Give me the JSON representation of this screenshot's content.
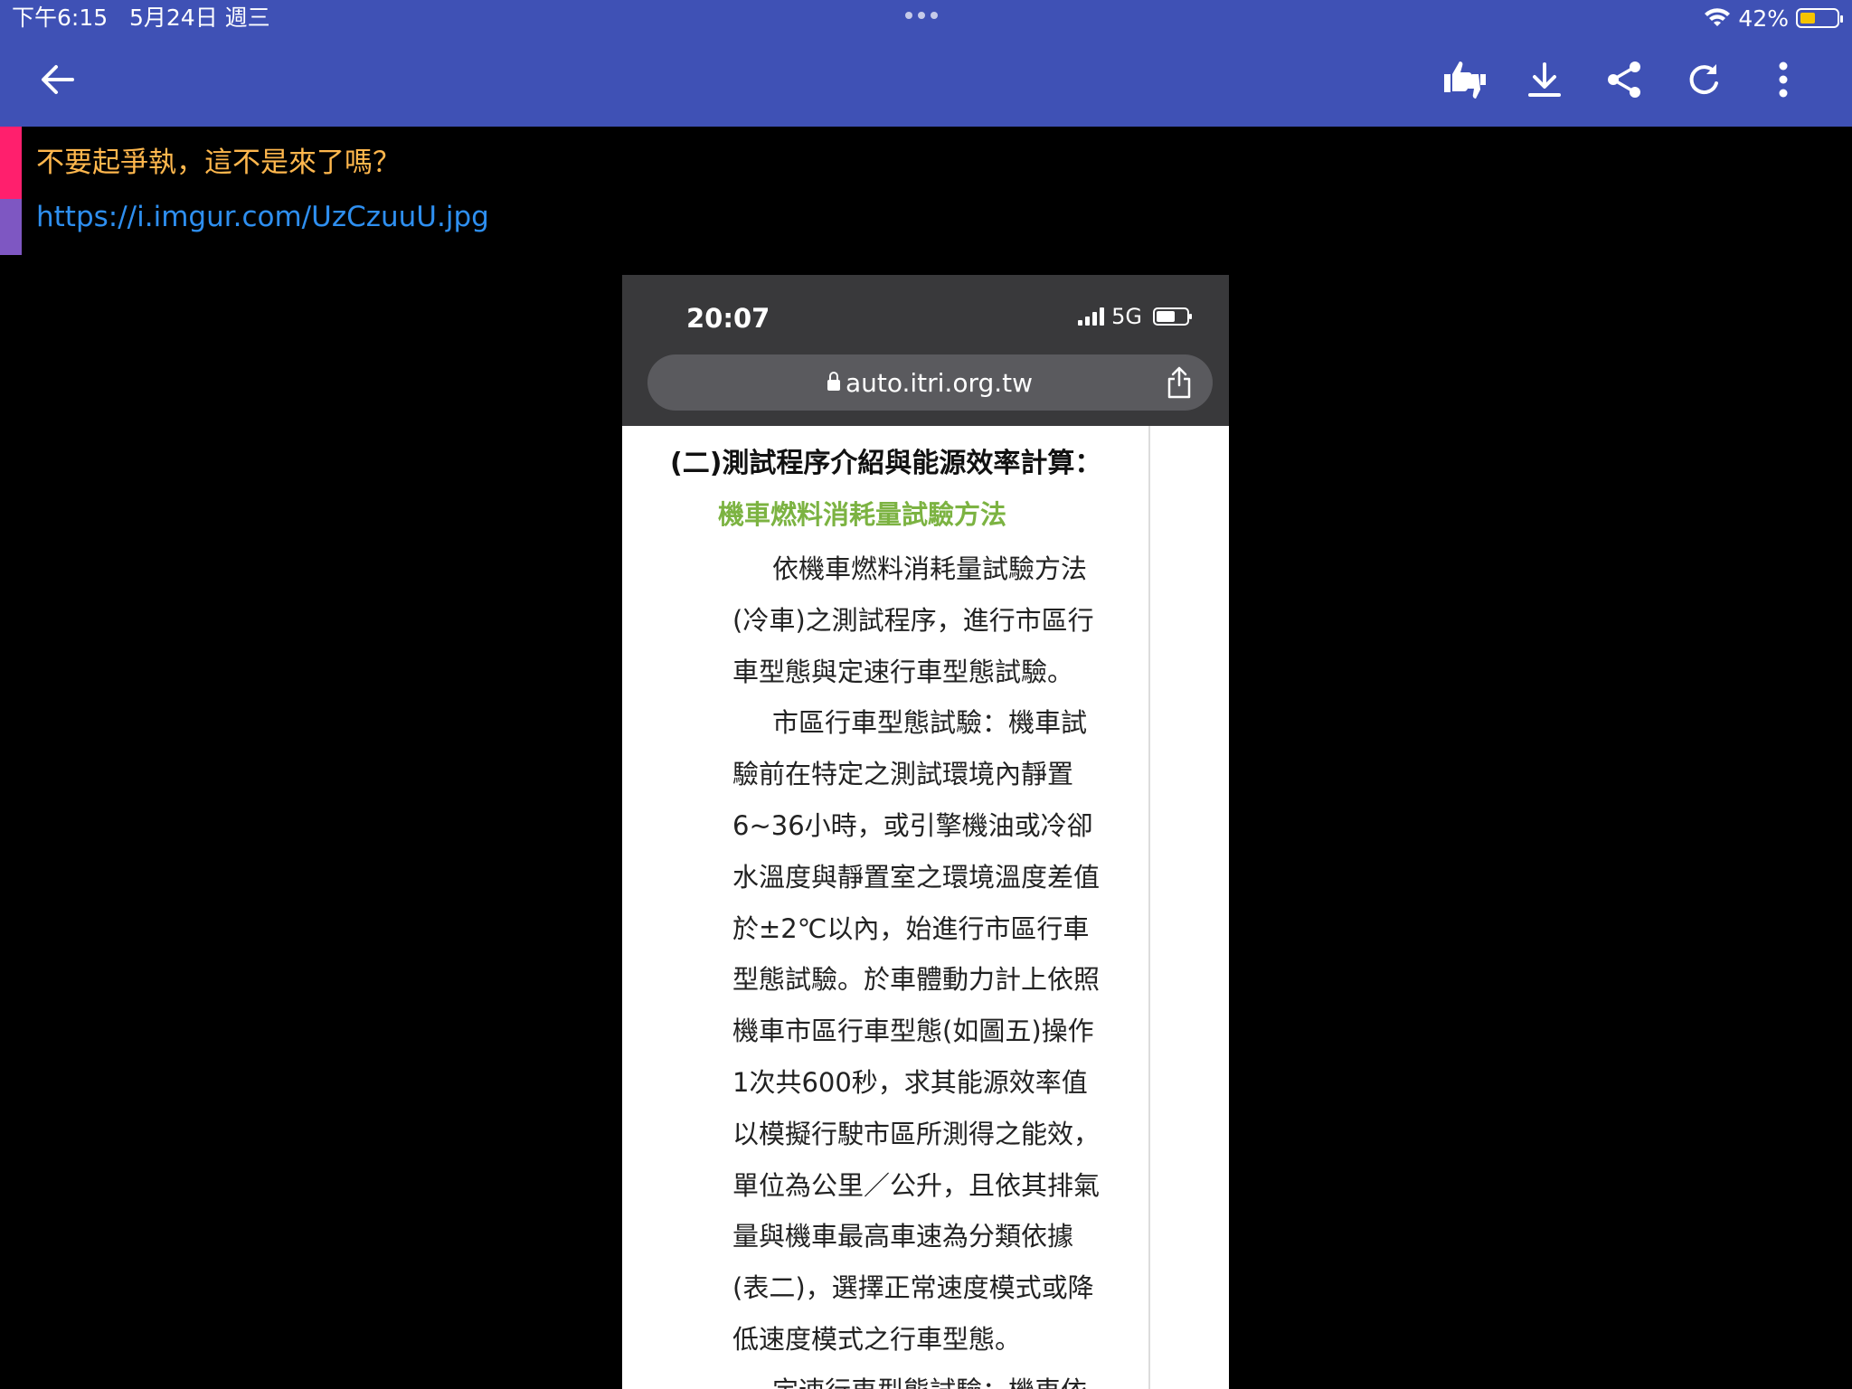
{
  "status_bar": {
    "time": "下午6:15",
    "date": "5月24日 週三",
    "battery_percent": "42%",
    "battery_level": 0.42,
    "wifi": "wifi-icon"
  },
  "toolbar": {
    "back": "arrow-left-icon",
    "actions": [
      "thumbs-up-down-icon",
      "download-icon",
      "share-icon",
      "refresh-icon",
      "more-vert-icon"
    ]
  },
  "post": {
    "quote_text": "不要起爭執，這不是來了嗎？",
    "link_text": "https://i.imgur.com/UzCzuuU.jpg",
    "accent_colors": [
      "#ff1f6d",
      "#7e57c2"
    ]
  },
  "embedded_screenshot": {
    "time": "20:07",
    "network": "5G",
    "url": "auto.itri.org.tw",
    "heading": "(二)測試程序介紹與能源效率計算：",
    "subheading": "機車燃料消耗量試驗方法",
    "body_lines": [
      "依機車燃料消耗量試驗方法",
      "(冷車)之測試程序，進行市區行",
      "車型態與定速行車型態試驗。",
      "市區行車型態試驗：機車試",
      "驗前在特定之測試環境內靜置",
      "6~36小時，或引擎機油或冷卻",
      "水溫度與靜置室之環境溫度差值",
      "於±2℃以內，始進行市區行車",
      "型態試驗。於車體動力計上依照",
      "機車市區行車型態(如圖五)操作",
      "1次共600秒，求其能源效率值",
      "以模擬行駛市區所測得之能效，",
      "單位為公里／公升，且依其排氣",
      "量與機車最高車速為分類依據",
      "(表二)，選擇正常速度模式或降",
      "低速度模式之行車型態。",
      "定速行車型態試驗：機車依"
    ],
    "colors": {
      "heading": "#111111",
      "subheading": "#7cb342",
      "body": "#222222"
    }
  }
}
